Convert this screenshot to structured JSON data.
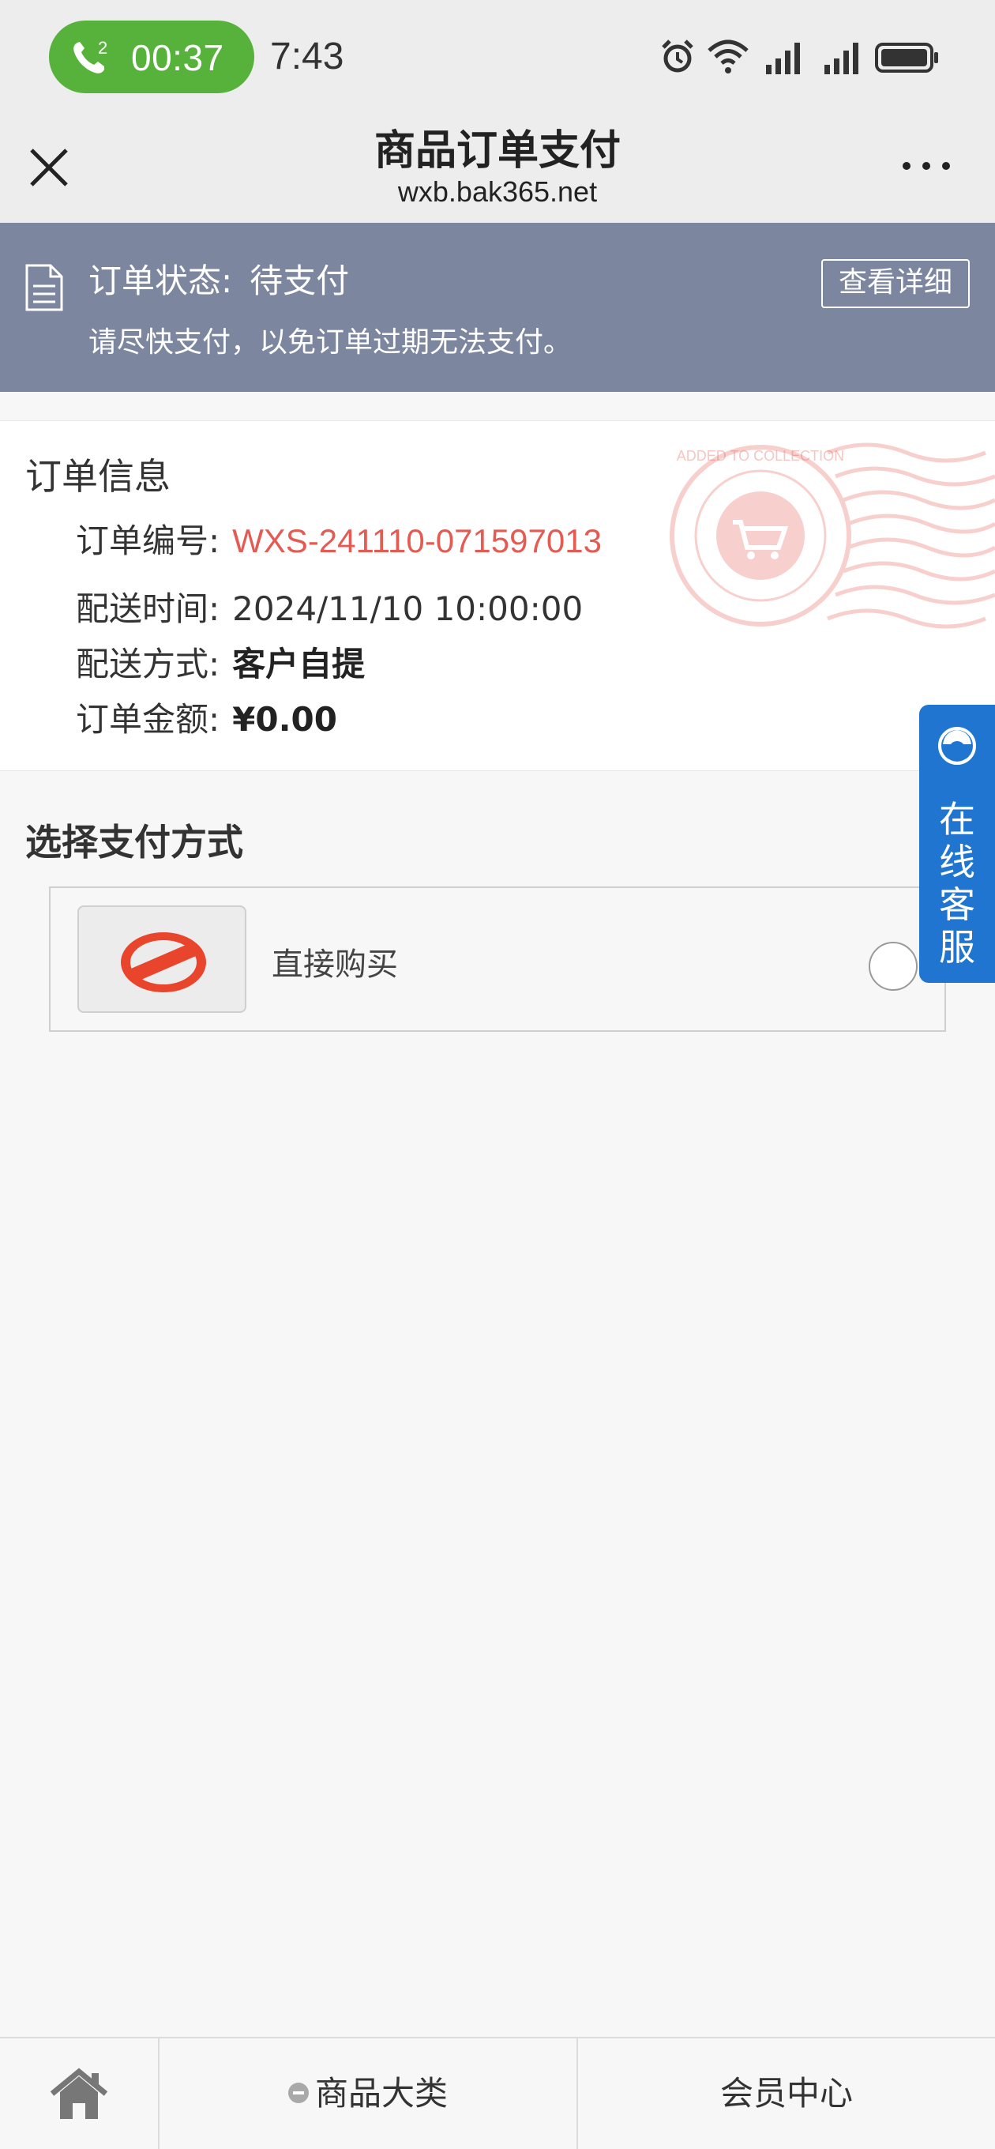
{
  "status_bar": {
    "call_timer": "00:37",
    "call_badge": "2",
    "time": "7:43",
    "icons": [
      "alarm-icon",
      "wifi-icon",
      "signal-icon",
      "signal-icon",
      "battery-icon"
    ],
    "call_color": "#57b23c"
  },
  "header": {
    "title": "商品订单支付",
    "url": "wxb.bak365.net",
    "close_icon": "close-icon",
    "more_icon": "more-icon"
  },
  "order_status": {
    "label": "订单状态:",
    "value": "待支付",
    "hint": "请尽快支付，以免订单过期无法支付。",
    "detail_button": "查看详细",
    "background": "#7c869e"
  },
  "order_info": {
    "title": "订单信息",
    "rows": [
      {
        "label": "订单编号:",
        "value": "WXS-241110-071597013"
      },
      {
        "label": "配送时间:",
        "value": "2024/11/10 10:00:00"
      },
      {
        "label": "配送方式:",
        "value": "客户自提"
      },
      {
        "label": "订单金额:",
        "value": "¥0.00"
      }
    ],
    "stamp_text": "ADDED TO COLLECTION",
    "highlight_color": "#e35b53"
  },
  "payment": {
    "title": "选择支付方式",
    "options": [
      {
        "label": "直接购买",
        "icon": "no-entry-icon"
      }
    ]
  },
  "support": {
    "label": "在线客服",
    "color": "#1f75d0"
  },
  "bottom_nav": {
    "home_icon": "home-icon",
    "category": "商品大类",
    "member": "会员中心"
  }
}
